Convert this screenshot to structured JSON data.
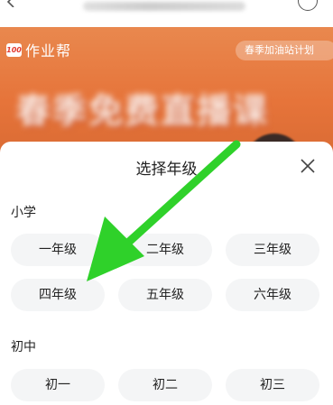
{
  "banner": {
    "brand_logo_text": "100",
    "brand_name": "作业帮",
    "campaign_tag": "春季加油站计划",
    "headline": "春季免费直播课"
  },
  "sheet": {
    "title": "选择年级",
    "sections": [
      {
        "label": "小学",
        "grades": [
          "一年级",
          "二年级",
          "三年级",
          "四年级",
          "五年级",
          "六年级"
        ]
      },
      {
        "label": "初中",
        "grades": [
          "初一",
          "初二",
          "初三"
        ]
      }
    ]
  },
  "colors": {
    "banner_orange": "#e6743a",
    "button_bg": "#f4f5f6",
    "annotation_green": "#2fd12a"
  },
  "icons": [
    "back-icon",
    "circle-icon",
    "close-icon",
    "annotation-arrow"
  ]
}
